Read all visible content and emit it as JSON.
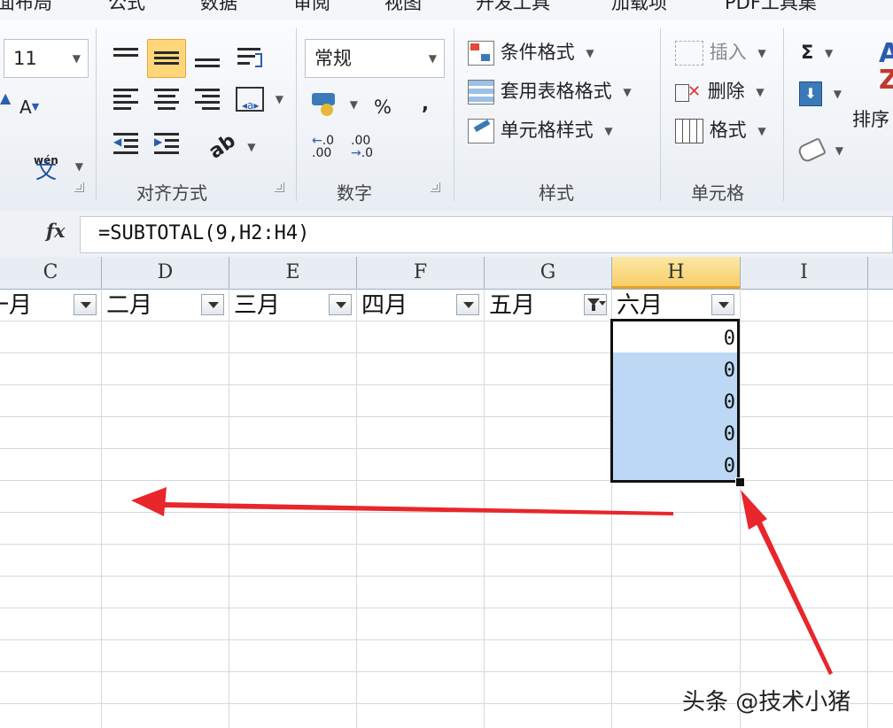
{
  "menu_tabs": [
    {
      "label": "面布局"
    },
    {
      "label": "公式"
    },
    {
      "label": "数据"
    },
    {
      "label": "审阅"
    },
    {
      "label": "视图"
    },
    {
      "label": "开发工具"
    },
    {
      "label": "加载项"
    },
    {
      "label": "PDF工具集"
    }
  ],
  "font_group": {
    "font_size": "11",
    "phonetic_icon_text": "wén"
  },
  "alignment_group": {
    "label": "对齐方式"
  },
  "number_group": {
    "label": "数字",
    "format_value": "常规",
    "percent_symbol": "%",
    "comma_symbol": ","
  },
  "styles_group": {
    "label": "样式",
    "conditional_format": "条件格式",
    "table_format": "套用表格格式",
    "cell_styles": "单元格样式"
  },
  "cells_group": {
    "label": "单元格",
    "insert": "插入",
    "delete": "删除",
    "format": "格式"
  },
  "editing_group": {
    "sum_symbol": "Σ",
    "sort_label": "排序"
  },
  "formula_bar": {
    "fx_label": "fx",
    "formula": "=SUBTOTAL(9,H2:H4)"
  },
  "columns": [
    {
      "letter": "C"
    },
    {
      "letter": "D"
    },
    {
      "letter": "E"
    },
    {
      "letter": "F"
    },
    {
      "letter": "G"
    },
    {
      "letter": "H"
    },
    {
      "letter": "I"
    }
  ],
  "header_row": [
    "一月",
    "二月",
    "三月",
    "四月",
    "五月",
    "六月"
  ],
  "column_h_values": [
    "0",
    "0",
    "0",
    "0",
    "0"
  ],
  "watermark": "头条 @技术小猪",
  "colors": {
    "selection_fill": "#bcd8f5",
    "active_header": "#f8cf68",
    "annotation_arrow": "#e8262b"
  }
}
